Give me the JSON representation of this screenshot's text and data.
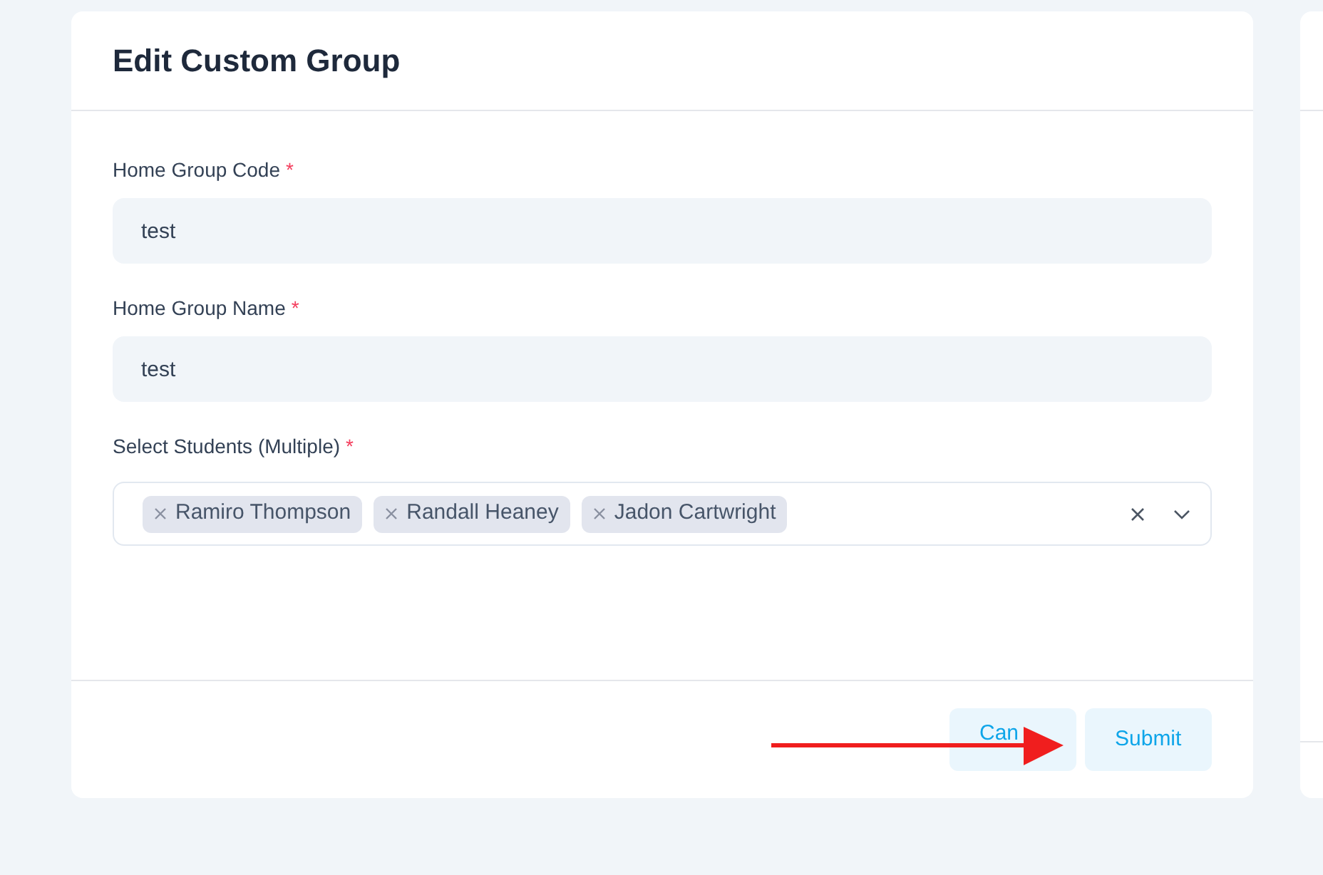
{
  "dialog": {
    "title": "Edit Custom Group"
  },
  "fields": [
    {
      "kind": "text",
      "label": "Home Group Code",
      "required_mark": "*",
      "value": "test"
    },
    {
      "kind": "text",
      "label": "Home Group Name",
      "required_mark": "*",
      "value": "test"
    },
    {
      "kind": "multiselect",
      "label": "Select Students (Multiple)",
      "required_mark": "*",
      "tags": [
        "Ramiro Thompson",
        "Randall Heaney",
        "Jadon Cartwright"
      ]
    }
  ],
  "buttons": [
    {
      "label": "Can"
    },
    {
      "label": "Submit"
    }
  ],
  "annotation": {
    "kind": "arrow"
  }
}
